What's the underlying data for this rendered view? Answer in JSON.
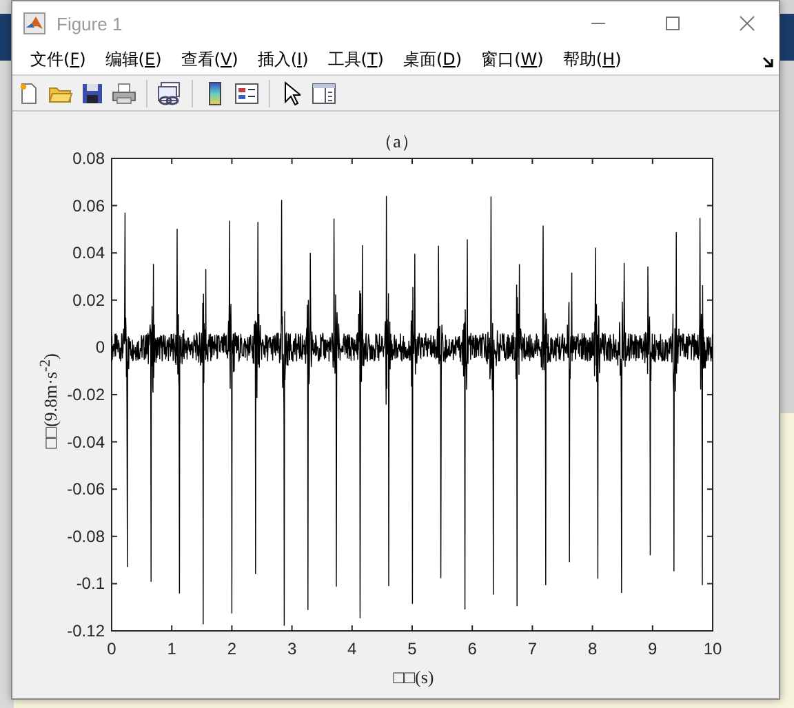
{
  "window": {
    "title": "Figure 1"
  },
  "menu": [
    {
      "label": "文件(F)"
    },
    {
      "label": "编辑(E)"
    },
    {
      "label": "查看(V)"
    },
    {
      "label": "插入(I)"
    },
    {
      "label": "工具(T)"
    },
    {
      "label": "桌面(D)"
    },
    {
      "label": "窗口(W)"
    },
    {
      "label": "帮助(H)"
    }
  ],
  "toolbar": [
    {
      "kind": "new"
    },
    {
      "kind": "open"
    },
    {
      "kind": "save"
    },
    {
      "kind": "print"
    },
    {
      "kind": "sep"
    },
    {
      "kind": "link"
    },
    {
      "kind": "sep"
    },
    {
      "kind": "colorbar"
    },
    {
      "kind": "legend"
    },
    {
      "kind": "sep"
    },
    {
      "kind": "pointer"
    },
    {
      "kind": "property"
    }
  ],
  "axes": {
    "title": "（a）",
    "xlabel": "□□(s)",
    "ylabel": "□□(9.8m·s$^{-2}$)",
    "yticks": [
      "0.08",
      "0.06",
      "0.04",
      "0.02",
      "0",
      "-0.02",
      "-0.04",
      "-0.06",
      "-0.08",
      "-0.1",
      "-0.12"
    ],
    "xticks": [
      "0",
      "1",
      "2",
      "3",
      "4",
      "5",
      "6",
      "7",
      "8",
      "9",
      "10"
    ]
  }
}
